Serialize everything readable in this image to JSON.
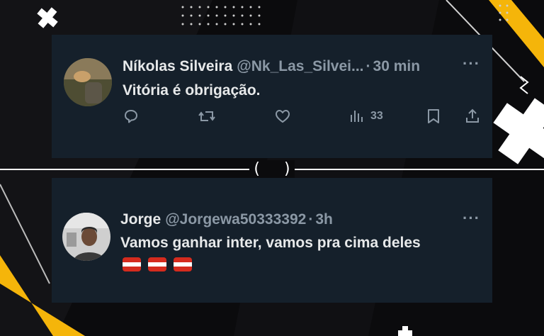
{
  "tweets": [
    {
      "display_name": "Níkolas Silveira",
      "handle": "@Nk_Las_Silvei...",
      "separator": "·",
      "time": "30 min",
      "text": "Vitória é obrigação.",
      "views": "33",
      "more": "···"
    },
    {
      "display_name": "Jorge",
      "handle": "@Jorgewa50333392",
      "separator": "·",
      "time": "3h",
      "text": "Vamos ganhar inter,  vamos pra cima deles",
      "more": "···",
      "flag_colors": [
        "#d52b1e",
        "#ffffff",
        "#d52b1e"
      ]
    }
  ],
  "divider": {
    "left": "(",
    "right": ")"
  },
  "colors": {
    "card_bg": "#15202b",
    "primary_text": "#e7e9ea",
    "secondary_text": "#8b98a5",
    "page_bg": "#0b0b0d",
    "accent_yellow": "#f5b50a"
  },
  "icons": [
    "reply-icon",
    "retweet-icon",
    "like-icon",
    "views-icon",
    "bookmark-icon",
    "share-icon",
    "more-icon"
  ]
}
